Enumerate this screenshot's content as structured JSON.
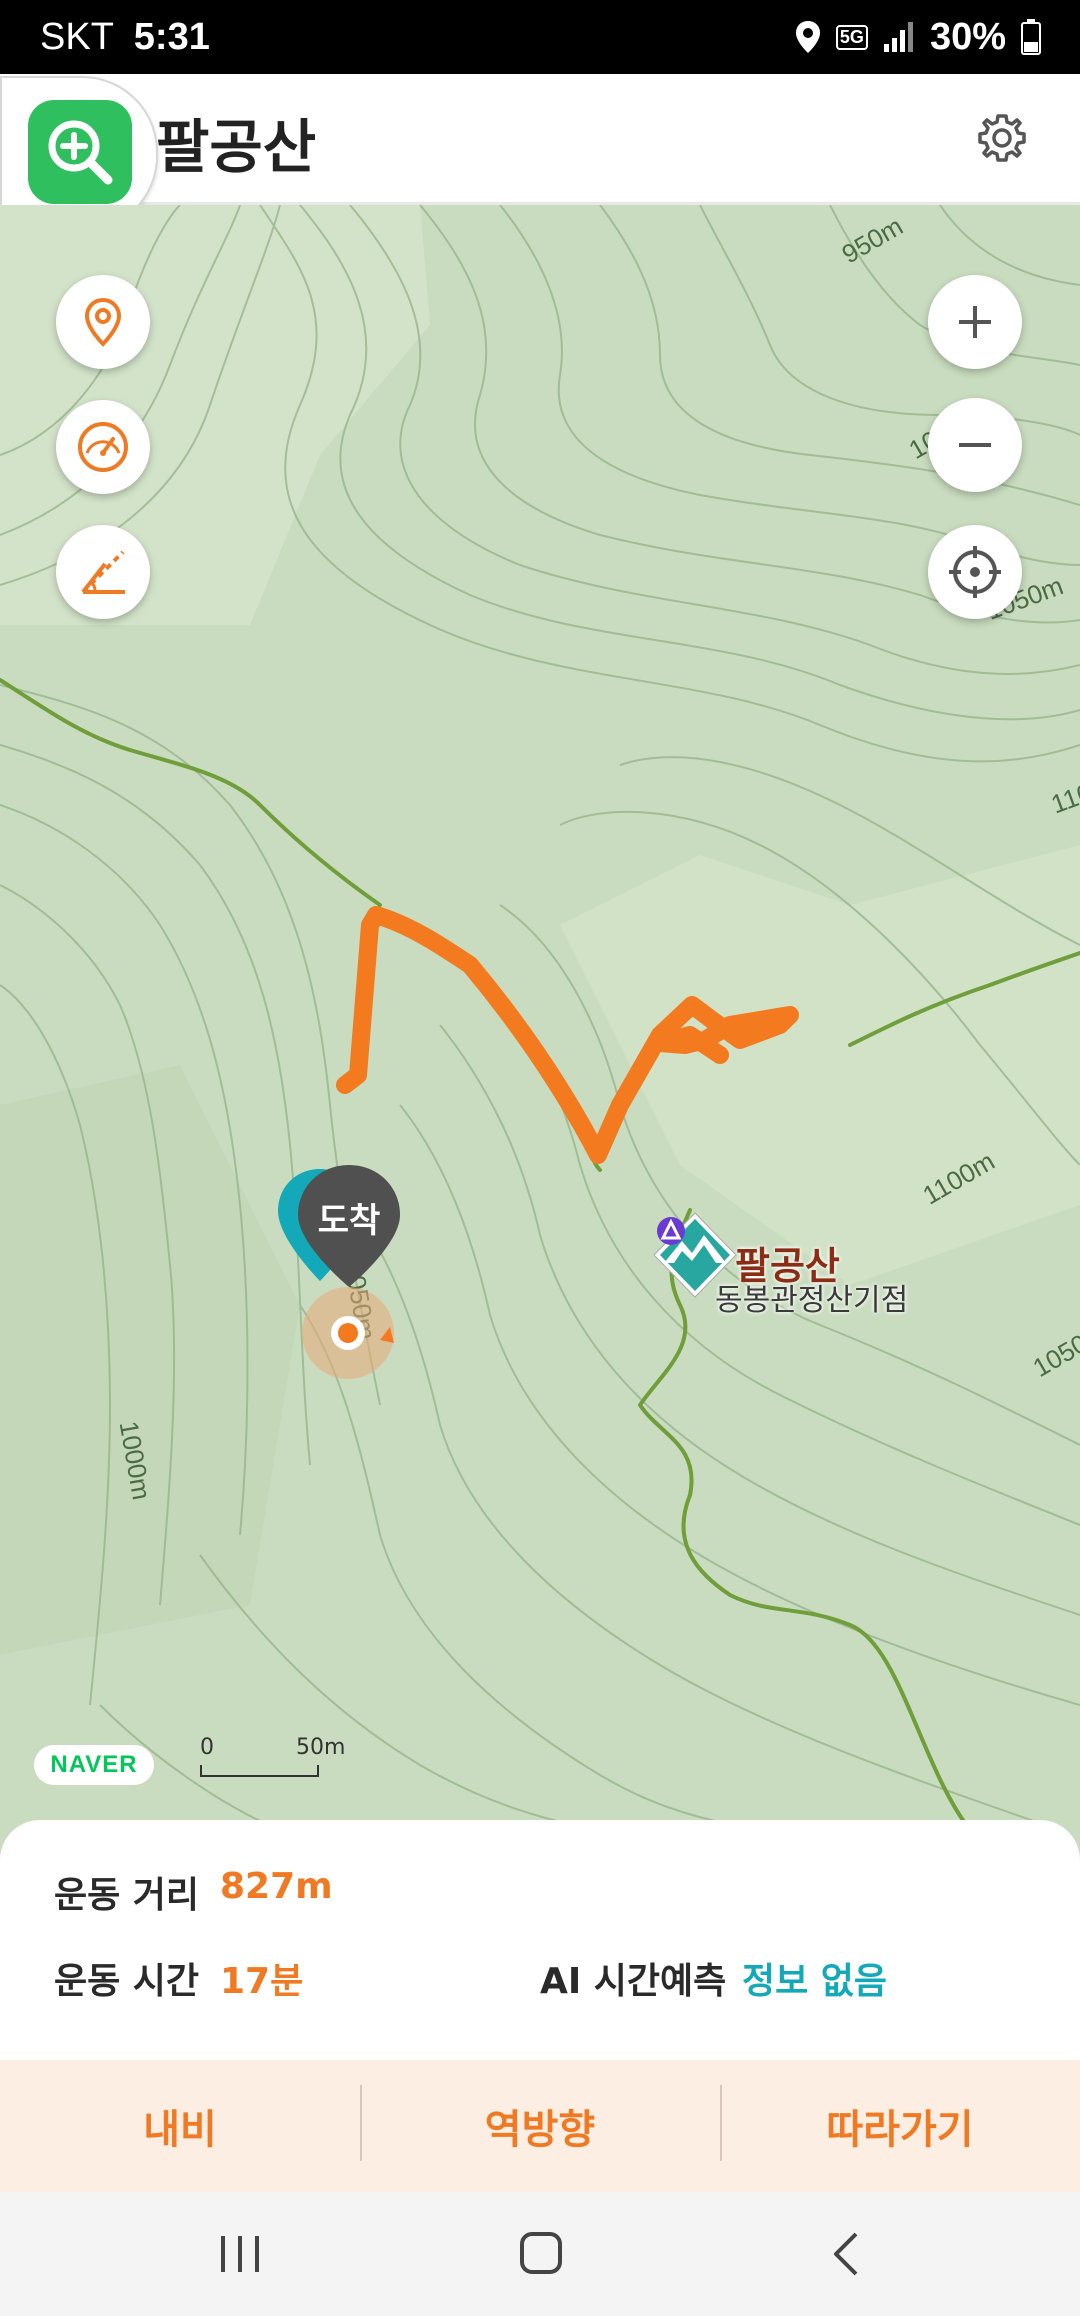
{
  "status_bar": {
    "carrier": "SKT",
    "time": "5:31",
    "network": "5G",
    "battery": "30%"
  },
  "header": {
    "title": "팔공산",
    "icons": [
      "zoom-in-icon",
      "gear-icon"
    ]
  },
  "map": {
    "controls_left": [
      "location-pin-icon",
      "speedometer-icon",
      "slope-icon"
    ],
    "controls_right": [
      "zoom-in-icon",
      "zoom-out-icon",
      "crosshair-icon"
    ],
    "arrive_label": "도착",
    "summit_name": "팔공산",
    "summit_sub": "동봉관정산기점",
    "contour_labels": [
      "950m",
      "1000m",
      "1050m",
      "1100m",
      "1050m",
      "1000m",
      "1050m",
      "1100m",
      "1050m"
    ],
    "provider": "NAVER",
    "scale": {
      "start": "0",
      "end": "50m"
    },
    "colors": {
      "track": "#f47a1f",
      "trail": "#6f9e3b",
      "terrain": "#c9dcbf"
    }
  },
  "stats": {
    "distance_label": "운동 거리",
    "distance_value": "827m",
    "time_label": "운동 시간",
    "time_value": "17분",
    "ai_label": "AI 시간예측",
    "ai_value": "정보 없음",
    "accent_orange": "#f07a23",
    "accent_teal": "#14a9b8"
  },
  "actions": {
    "nav": "내비",
    "reverse": "역방향",
    "follow": "따라가기"
  },
  "nav_bar": [
    "recent-apps-icon",
    "home-icon",
    "back-icon"
  ]
}
